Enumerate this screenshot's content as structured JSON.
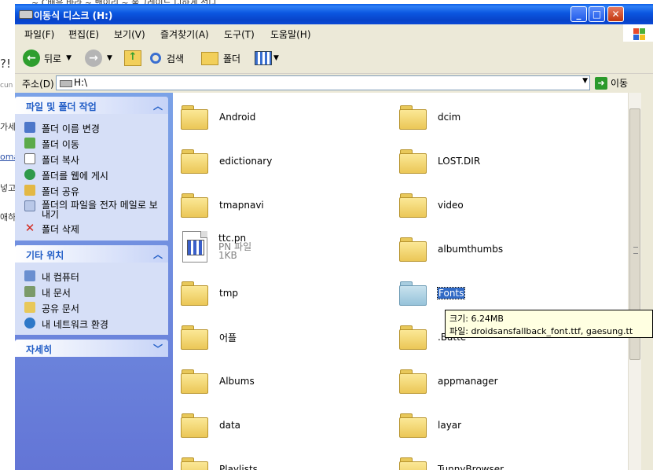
{
  "background_page": {
    "header_fragment": "~ C배음 바라 ~ 밴이리 ~ 울그레이드 디하게 선디",
    "fragments": [
      "?!",
      "cun",
      "가세",
      "oma",
      "넣고",
      "애하"
    ]
  },
  "window": {
    "title": "이동식 디스크 (H:)",
    "controls": {
      "minimize": "_",
      "maximize": "□",
      "close": "✕"
    }
  },
  "menu": [
    "파일(F)",
    "편집(E)",
    "보기(V)",
    "즐겨찾기(A)",
    "도구(T)",
    "도움말(H)"
  ],
  "toolbar": {
    "back": "뒤로",
    "search": "검색",
    "folders": "폴더"
  },
  "address": {
    "label": "주소(D)",
    "value": "H:\\",
    "go": "이동"
  },
  "taskpane": {
    "file_tasks": {
      "title": "파일 및 폴더 작업",
      "items": [
        "폴더 이름 변경",
        "폴더 이동",
        "폴더 복사",
        "폴더를 웹에 게시",
        "폴더 공유",
        "폴더의 파일을 전자 메일로 보내기",
        "폴더 삭제"
      ]
    },
    "other_places": {
      "title": "기타 위치",
      "items": [
        "내 컴퓨터",
        "내 문서",
        "공유 문서",
        "내 네트워크 환경"
      ]
    },
    "details": {
      "title": "자세히"
    }
  },
  "files": {
    "col1": [
      "Android",
      "edictionary",
      "tmapnavi",
      "ttc.pn",
      "tmp",
      "어플",
      "Albums",
      "data",
      "Playlists"
    ],
    "col2": [
      "dcim",
      "LOST.DIR",
      "video",
      "albumthumbs",
      "Fonts",
      ".Batte",
      "appmanager",
      "layar",
      "TunnyBrowser"
    ],
    "ttc_type": "PN 파일",
    "ttc_size": "1KB"
  },
  "tooltip": {
    "size": "크기: 6.24MB",
    "files": "파일: droidsansfallback_font.ttf, gaesung.tt"
  },
  "colors": {
    "titlebar": "#0b56e0",
    "taskpane": "#6f8fdd",
    "selection": "#316ac5"
  }
}
